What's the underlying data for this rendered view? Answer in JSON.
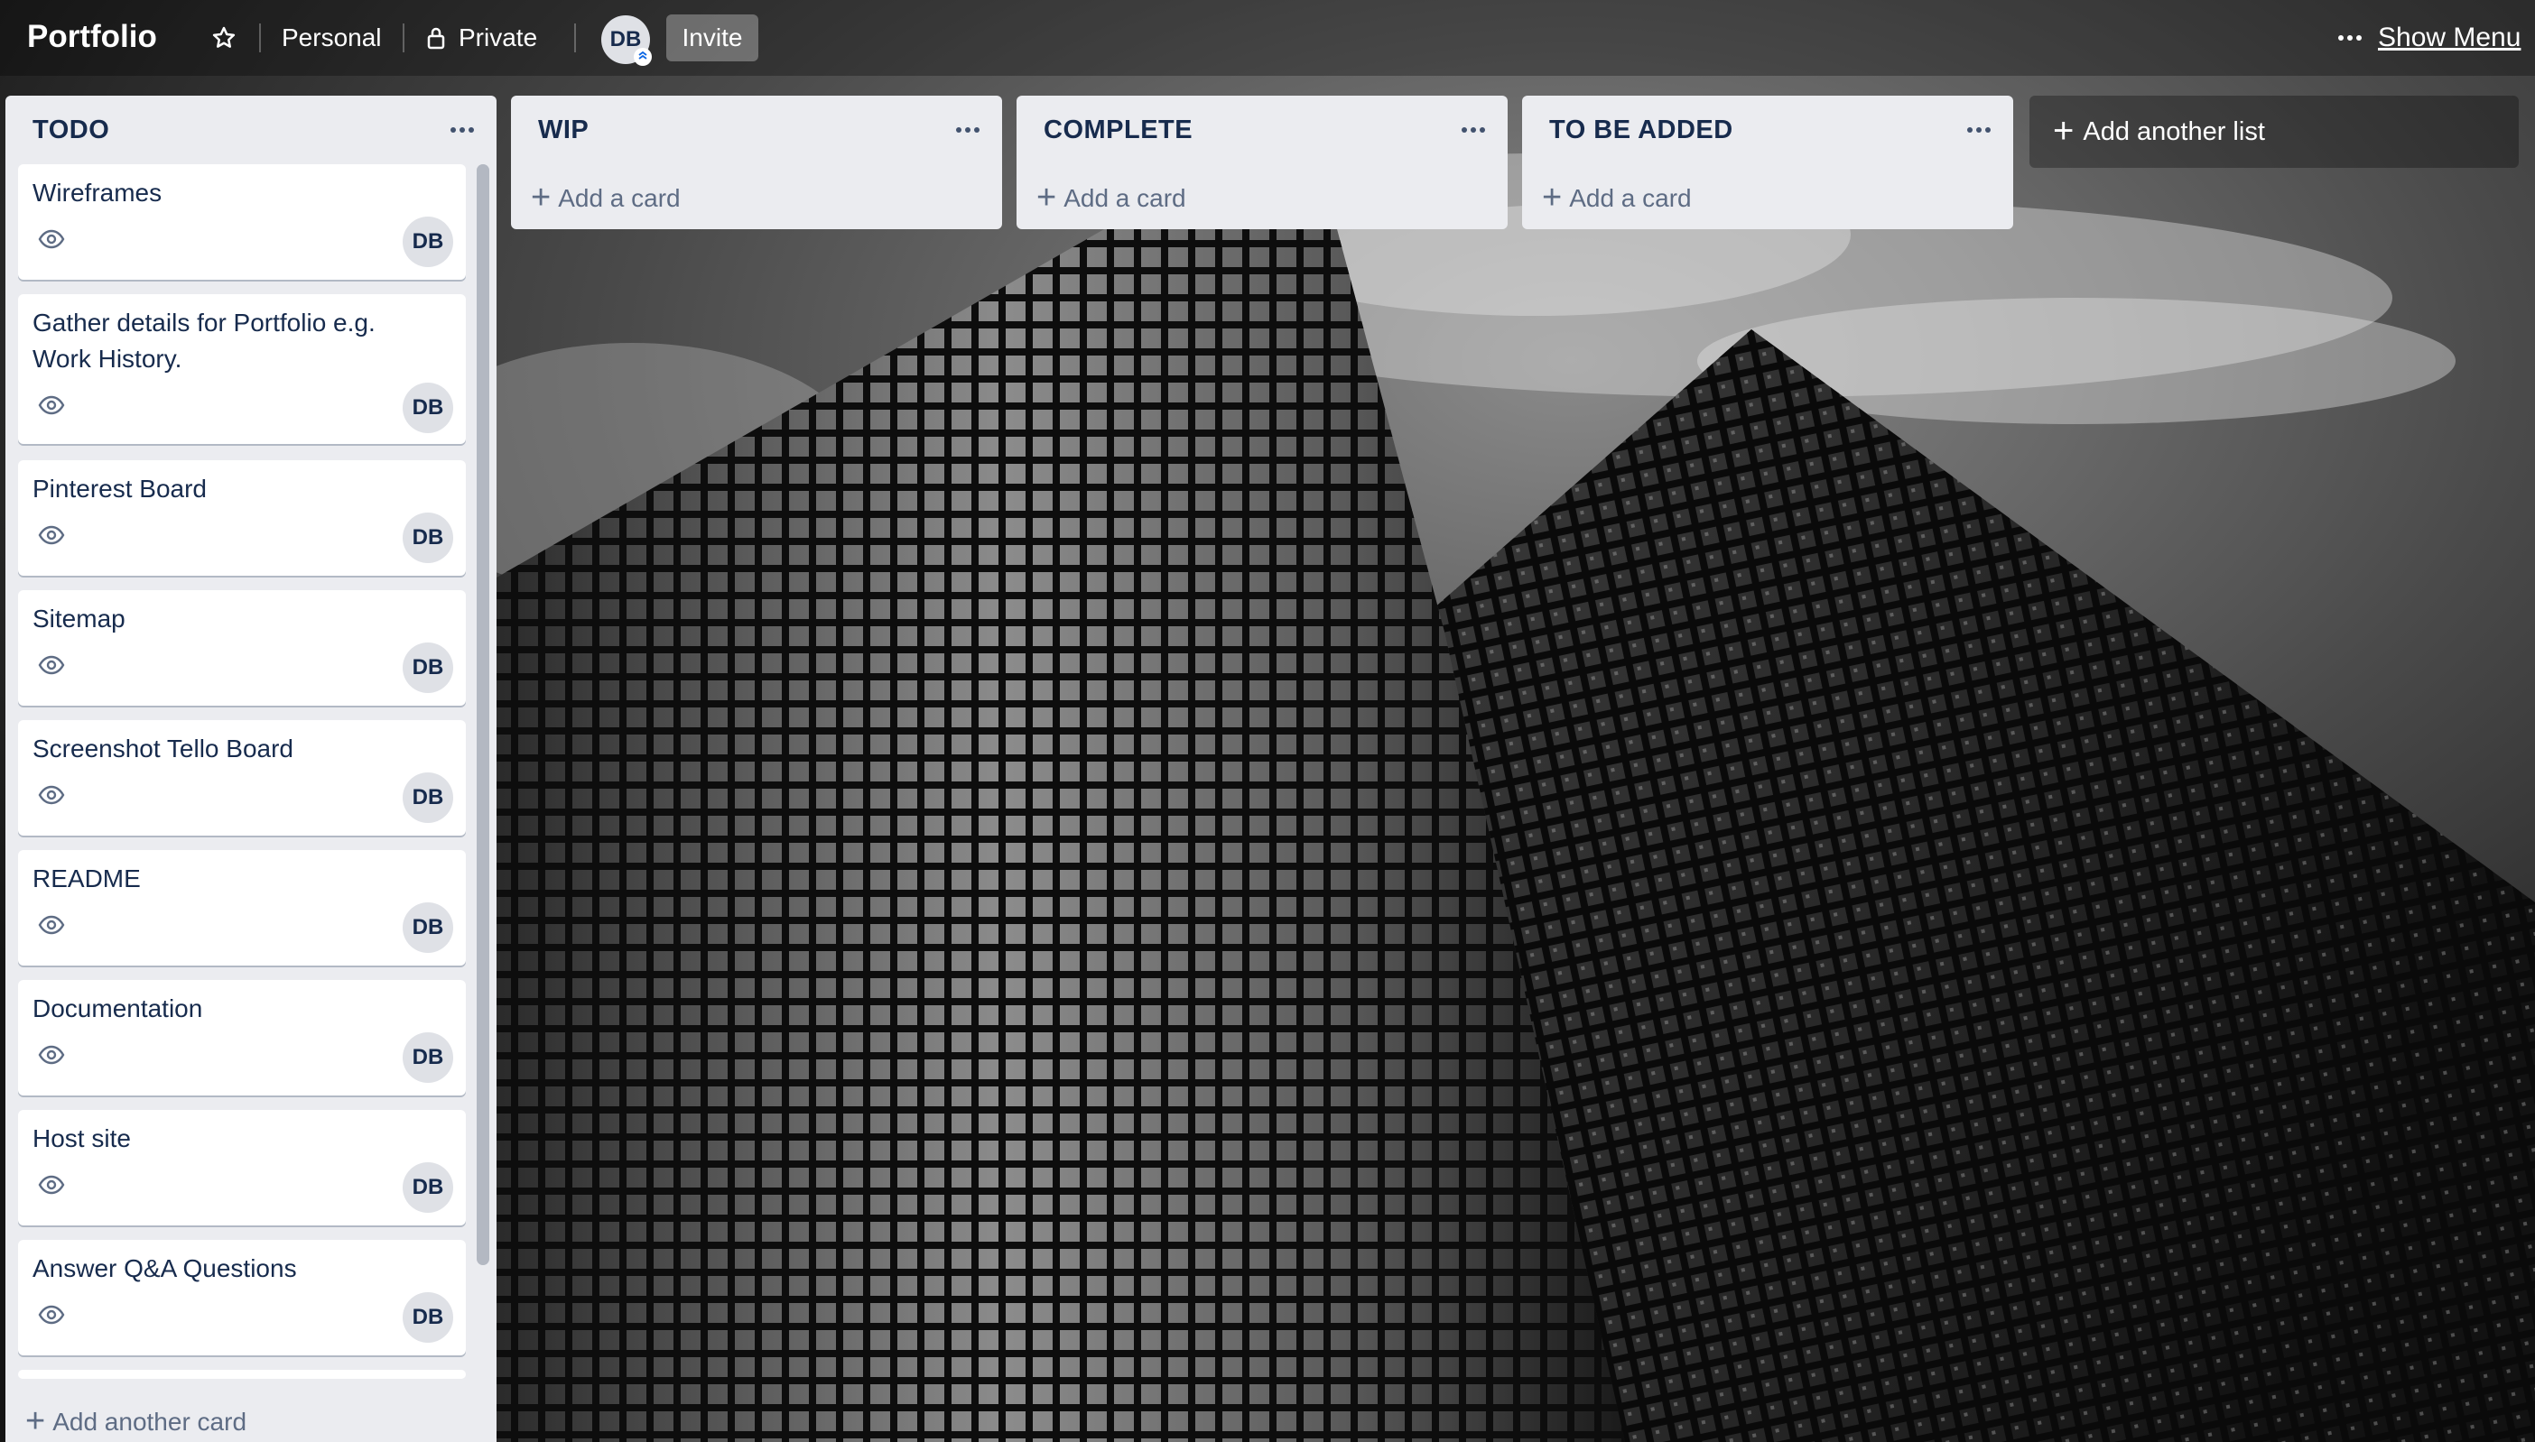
{
  "header": {
    "board_title": "Portfolio",
    "workspace_label": "Personal",
    "visibility_label": "Private",
    "member_initials": "DB",
    "invite_label": "Invite",
    "show_menu_label": "Show Menu"
  },
  "lists": [
    {
      "title": "TODO",
      "add_card_label": "Add another card",
      "cards": [
        {
          "title": "Wireframes",
          "member": "DB"
        },
        {
          "title": "Gather details for Portfolio e.g. Work History.",
          "member": "DB"
        },
        {
          "title": "Pinterest Board",
          "member": "DB"
        },
        {
          "title": "Sitemap",
          "member": "DB"
        },
        {
          "title": "Screenshot Tello Board",
          "member": "DB"
        },
        {
          "title": "README",
          "member": "DB"
        },
        {
          "title": "Documentation",
          "member": "DB"
        },
        {
          "title": "Host site",
          "member": "DB"
        },
        {
          "title": "Answer Q&A Questions",
          "member": "DB"
        }
      ]
    },
    {
      "title": "WIP",
      "add_card_label": "Add a card"
    },
    {
      "title": "COMPLETE",
      "add_card_label": "Add a card"
    },
    {
      "title": "TO BE ADDED",
      "add_card_label": "Add a card"
    }
  ],
  "add_list_label": "Add another list",
  "icons": {
    "star": "star-icon",
    "lock": "lock-icon",
    "watch": "eye-icon",
    "more": "more-horizontal-icon",
    "add": "plus-icon"
  },
  "colors": {
    "list_bg": "#ebecf0",
    "card_bg": "#ffffff",
    "text_dark": "#172b4d",
    "text_muted": "#5e6c84",
    "avatar_bg": "#dfe1e6"
  }
}
